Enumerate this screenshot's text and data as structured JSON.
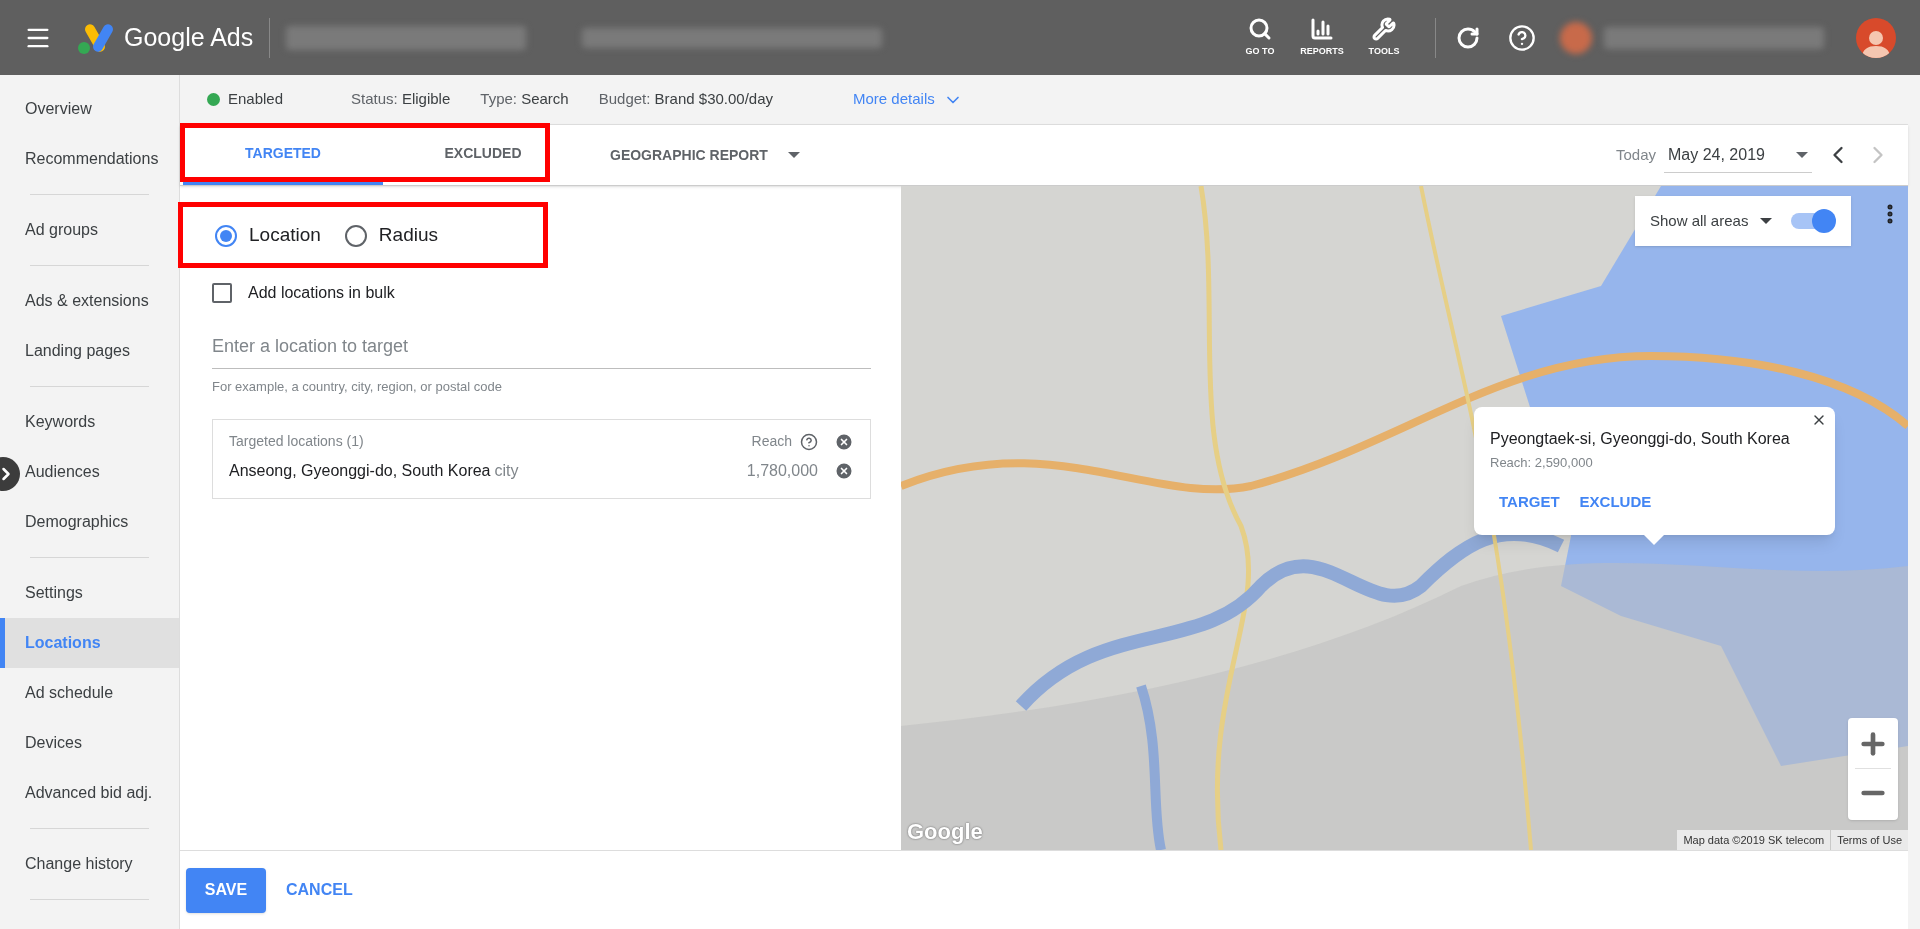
{
  "top_bar": {
    "product": "Google Ads",
    "actions": [
      {
        "kind": "search",
        "label": "GO TO"
      },
      {
        "kind": "reports",
        "label": "REPORTS"
      },
      {
        "kind": "tools",
        "label": "TOOLS"
      }
    ]
  },
  "sidebar": {
    "groups": [
      [
        {
          "label": "Overview",
          "selected": false
        },
        {
          "label": "Recommendations",
          "selected": false
        }
      ],
      [
        {
          "label": "Ad groups",
          "selected": false
        }
      ],
      [
        {
          "label": "Ads & extensions",
          "selected": false
        },
        {
          "label": "Landing pages",
          "selected": false
        }
      ],
      [
        {
          "label": "Keywords",
          "selected": false
        },
        {
          "label": "Audiences",
          "selected": false
        },
        {
          "label": "Demographics",
          "selected": false
        }
      ],
      [
        {
          "label": "Settings",
          "selected": false
        },
        {
          "label": "Locations",
          "selected": true
        },
        {
          "label": "Ad schedule",
          "selected": false
        },
        {
          "label": "Devices",
          "selected": false
        },
        {
          "label": "Advanced bid adj.",
          "selected": false
        }
      ],
      [
        {
          "label": "Change history",
          "selected": false
        }
      ]
    ]
  },
  "status_bar": {
    "state": {
      "label": "Enabled",
      "color": "#34a853"
    },
    "items": [
      {
        "label": "Status:",
        "value": "Eligible"
      },
      {
        "label": "Type:",
        "value": "Search"
      },
      {
        "label": "Budget:",
        "value": "Brand $30.00/day"
      }
    ],
    "more_details": "More details"
  },
  "tabs": [
    {
      "label": "TARGETED",
      "selected": true
    },
    {
      "label": "EXCLUDED",
      "selected": false
    }
  ],
  "report_dropdown": "GEOGRAPHIC REPORT",
  "date": {
    "label": "Today",
    "value": "May 24, 2019",
    "next_disabled": true
  },
  "location_mode": [
    {
      "label": "Location",
      "selected": true
    },
    {
      "label": "Radius",
      "selected": false
    }
  ],
  "bulk": {
    "label": "Add locations in bulk",
    "checked": false
  },
  "search": {
    "placeholder": "Enter a location to target",
    "hint": "For example, a country, city, region, or postal code"
  },
  "targeted": {
    "title": "Targeted locations (1)",
    "reach_label": "Reach",
    "rows": [
      {
        "name": "Anseong, Gyeonggi-do, South Korea",
        "type": "city",
        "reach": "1,780,000"
      }
    ]
  },
  "map": {
    "show_all": {
      "label": "Show all areas",
      "on": true
    },
    "popup": {
      "title": "Pyeongtaek-si, Gyeonggi-do, South Korea",
      "reach": "Reach: 2,590,000",
      "actions": [
        "TARGET",
        "EXCLUDE"
      ]
    },
    "logo": "Google",
    "attribution": "Map data ©2019 SK telecom",
    "terms": "Terms of Use"
  },
  "footer": {
    "save": "SAVE",
    "cancel": "CANCEL"
  }
}
